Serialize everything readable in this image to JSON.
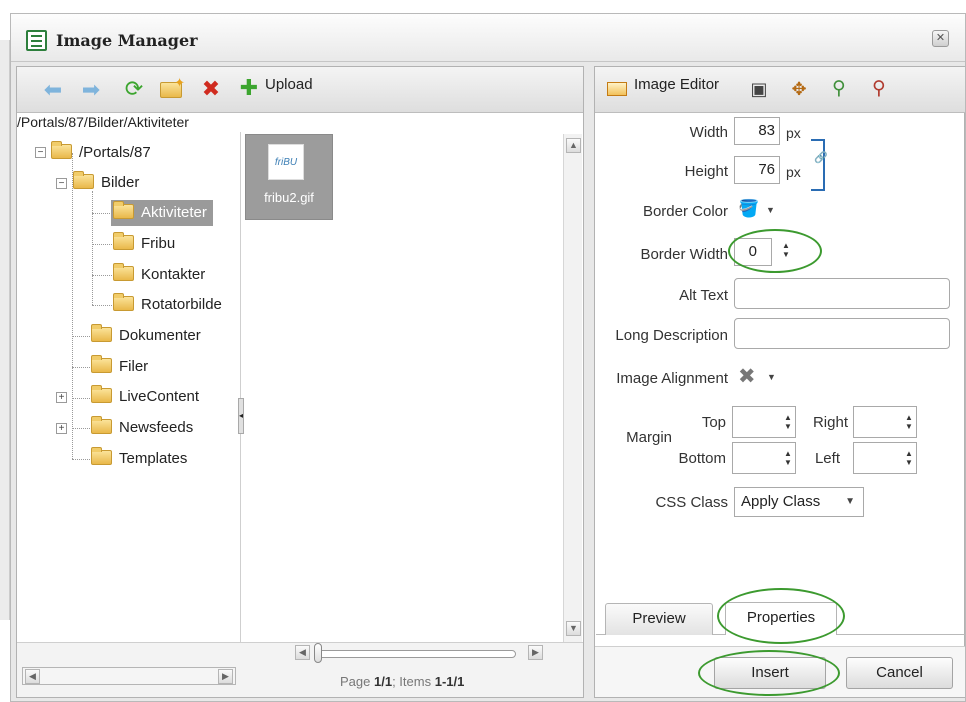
{
  "window": {
    "title": "Image Manager",
    "close_glyph": "✕"
  },
  "left_toolbar": {
    "icons": [
      "back-arrow-icon",
      "forward-arrow-icon",
      "refresh-icon",
      "new-folder-icon",
      "delete-icon",
      "upload-plus-icon"
    ],
    "upload_label": "Upload"
  },
  "path": "/Portals/87/Bilder/Aktiviteter",
  "tree": {
    "root": "/Portals/87",
    "bilder": "Bilder",
    "aktiviteter": "Aktiviteter",
    "fribu": "Fribu",
    "kontakter": "Kontakter",
    "rotatorbilder": "Rotatorbilde",
    "dokumenter": "Dokumenter",
    "filer": "Filer",
    "livecontent": "LiveContent",
    "newsfeeds": "Newsfeeds",
    "templates": "Templates"
  },
  "files": [
    {
      "name": "fribu2.gif",
      "thumb_text": "friBU"
    }
  ],
  "pager": {
    "page_label": "Page",
    "page_value": "1/1",
    "items_label": "; Items",
    "items_value": "1-1/1"
  },
  "image_editor": {
    "label": "Image Editor",
    "width_label": "Width",
    "width_value": "83",
    "width_unit": "px",
    "height_label": "Height",
    "height_value": "76",
    "height_unit": "px",
    "border_color_label": "Border Color",
    "border_width_label": "Border Width",
    "border_width_value": "0",
    "alt_text_label": "Alt Text",
    "alt_text_value": "",
    "long_desc_label": "Long Description",
    "long_desc_value": "",
    "alignment_label": "Image Alignment",
    "margin_label": "Margin",
    "margin_top_label": "Top",
    "margin_right_label": "Right",
    "margin_bottom_label": "Bottom",
    "margin_left_label": "Left",
    "css_class_label": "CSS Class",
    "css_class_value": "Apply Class"
  },
  "tabs": {
    "preview": "Preview",
    "properties": "Properties"
  },
  "buttons": {
    "insert": "Insert",
    "cancel": "Cancel"
  },
  "colors": {
    "highlight_ring": "#3c9a2f",
    "selected_row": "#9a9a9a",
    "link_blue": "#2a6cb3"
  }
}
